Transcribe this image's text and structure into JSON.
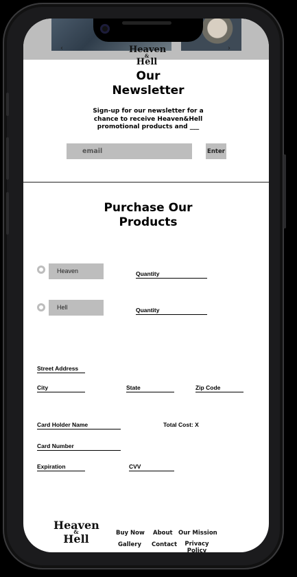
{
  "hero": {
    "logo_top": "Heaven",
    "logo_mid": "&",
    "logo_bottom": "Hell",
    "prev_arrow": "‹",
    "next_arrow": "›"
  },
  "newsletter": {
    "title_line1": "Our",
    "title_line2": "Newsletter",
    "text": "Sign-up for our newsletter for a chance to receive Heaven&Hell promotional products and ___",
    "email_placeholder": "email",
    "enter_label": "Enter"
  },
  "purchase": {
    "title_line1": "Purchase Our",
    "title_line2": "Products",
    "products": [
      {
        "label": "Heaven",
        "quantity_label": "Quantity"
      },
      {
        "label": "Hell",
        "quantity_label": "Quantity"
      }
    ],
    "street_label": "Street Address",
    "city_label": "City",
    "state_label": "State",
    "zip_label": "Zip Code",
    "card_holder_label": "Card Holder Name",
    "total_cost": "Total Cost: X",
    "card_number_label": "Card Number",
    "expiration_label": "Expiration",
    "cvv_label": "CVV"
  },
  "footer": {
    "logo_top": "Heaven",
    "logo_mid": "&",
    "logo_bottom": "Hell",
    "links": [
      "Buy Now",
      "About",
      "Our Mission",
      "Gallery",
      "Contact",
      "Privacy Policy"
    ]
  }
}
